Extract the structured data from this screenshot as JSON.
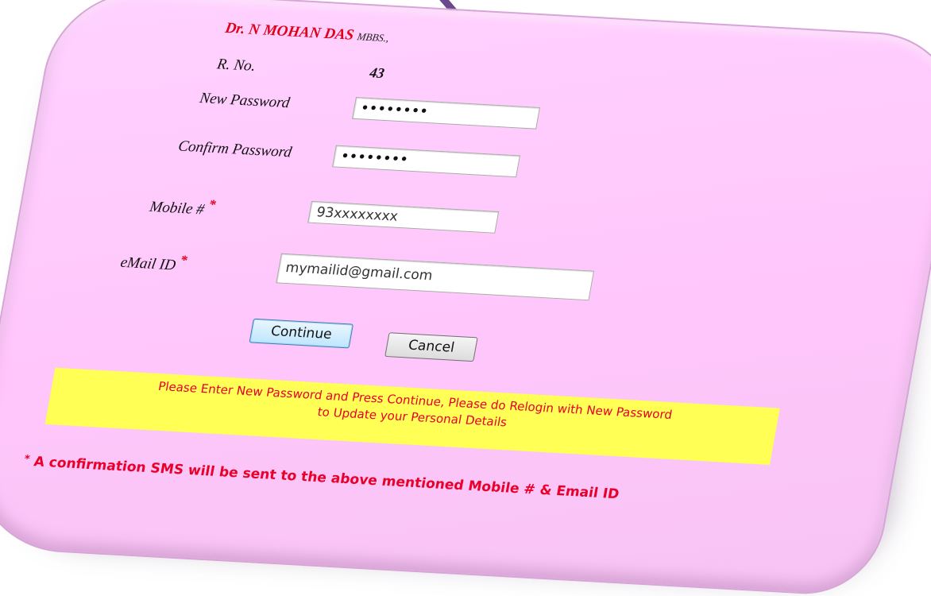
{
  "doctor": {
    "name": "Dr. N MOHAN DAS",
    "degree": "MBBS.,"
  },
  "registration": {
    "label": "R. No.",
    "value": "43"
  },
  "form": {
    "new_password_label": "New Password",
    "new_password_value": "••••••••",
    "confirm_password_label": "Confirm Password",
    "confirm_password_value": "••••••••",
    "mobile_label": "Mobile #",
    "mobile_value": "93xxxxxxxx",
    "email_label": "eMail ID",
    "email_value": "mymailid@gmail.com",
    "required_marker": "*"
  },
  "buttons": {
    "continue": "Continue",
    "cancel": "Cancel"
  },
  "notice": {
    "line1": "Please Enter New Password and Press Continue, Please do Relogin with New Password",
    "line2": "to Update your Personal Details"
  },
  "footnote": {
    "marker": "*",
    "text": "A confirmation SMS will be sent to the above mentioned Mobile # & Email ID"
  },
  "colors": {
    "card_background": "#ffc6fb",
    "accent_red": "#e8002a",
    "notice_background": "#ffff55",
    "arrow": "#7a4fa0"
  },
  "icons": {
    "pointer": "down-arrow-icon"
  }
}
